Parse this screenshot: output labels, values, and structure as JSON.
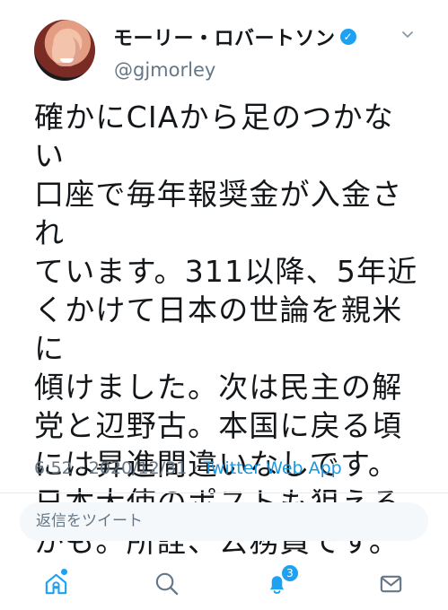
{
  "tweet": {
    "author": {
      "display_name": "モーリー・ロバートソン",
      "verified": true,
      "verified_icon": "check-verified-icon",
      "handle": "@gjmorley"
    },
    "text": "確かにCIAから足のつかない\n口座で毎年報奨金が入金され\nています。311以降、5年近\nくかけて日本の世論を親米に\n傾けました。次は民主の解\n党と辺野古。本国に戻る頃\nには昇進間違いなしです。\n日本大使のポストも狙える\nかも。所詮、公務員です。",
    "timestamp": "6:52 · 2020/12/31 · ",
    "source": "Twitter Web App"
  },
  "reply": {
    "placeholder": "返信をツイート"
  },
  "navigation": {
    "items": [
      {
        "label": "home",
        "icon": "home-icon"
      },
      {
        "label": "search",
        "icon": "search-icon"
      },
      {
        "label": "notifications",
        "icon": "bell-icon",
        "badge": "3"
      },
      {
        "label": "messages",
        "icon": "mail-icon"
      }
    ]
  },
  "colors": {
    "accent": "#1da1f2",
    "link": "#1b95e0",
    "secondary_text": "#657786",
    "reply_background": "#f5f8fa"
  }
}
